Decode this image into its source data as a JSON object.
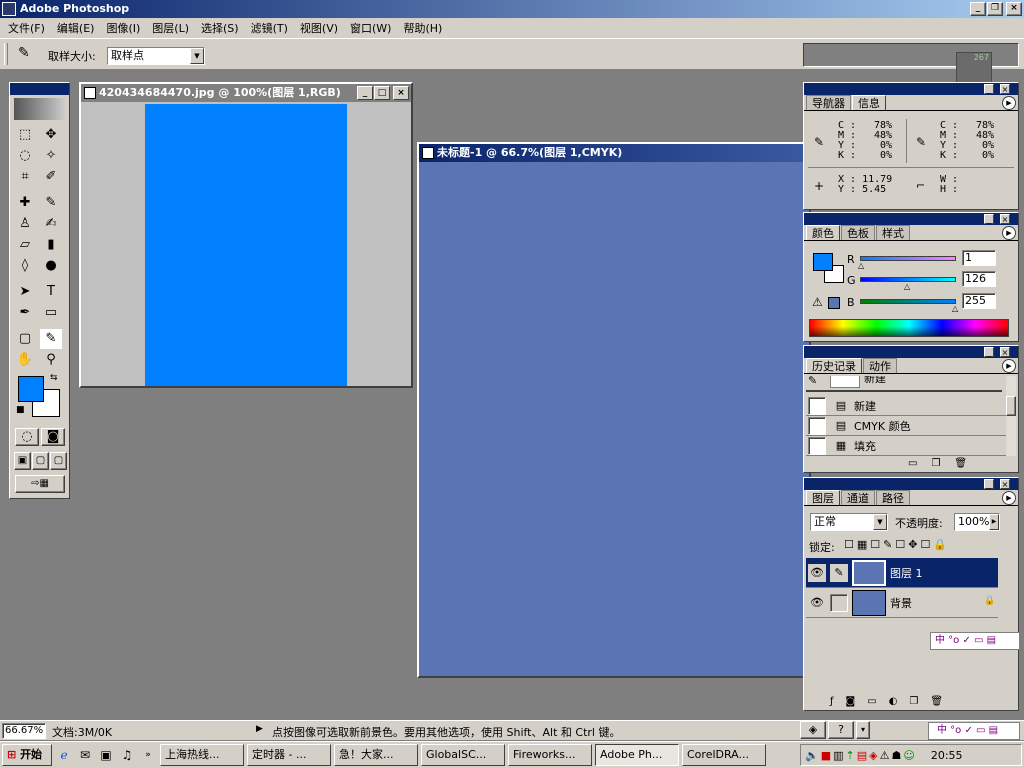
{
  "app": {
    "title": "Adobe Photoshop"
  },
  "menu": [
    "文件(F)",
    "编辑(E)",
    "图像(I)",
    "图层(L)",
    "选择(S)",
    "滤镜(T)",
    "视图(V)",
    "窗口(W)",
    "帮助(H)"
  ],
  "options": {
    "sample_label": "取样大小:",
    "sample_value": "取样点"
  },
  "documents": [
    {
      "title": "420434684470.jpg @ 100%(图层 1,RGB)",
      "fill": "#0080ff"
    },
    {
      "title": "未标题-1 @ 66.7%(图层 1,CMYK)",
      "fill": "#5a74b4"
    }
  ],
  "navigator": {
    "tabs": [
      "导航器",
      "信息"
    ],
    "cmyk_labels": [
      "C :",
      "M :",
      "Y :",
      "K :"
    ],
    "cmyk1": [
      "78%",
      "48%",
      "0%",
      "0%"
    ],
    "cmyk2": [
      "78%",
      "48%",
      "0%",
      "0%"
    ],
    "x": "X : 11.79",
    "y": "Y :  5.45",
    "w": "W :",
    "h": "H :"
  },
  "color": {
    "tabs": [
      "颜色",
      "色板",
      "样式"
    ],
    "labels": [
      "R",
      "G",
      "B"
    ],
    "values": [
      "1",
      "126",
      "255"
    ],
    "foreground": "#0080ff"
  },
  "history": {
    "tabs": [
      "历史记录",
      "动作"
    ],
    "top_item": "新建",
    "items": [
      "新建",
      "CMYK 颜色",
      "填充"
    ]
  },
  "layers": {
    "tabs": [
      "图层",
      "通道",
      "路径"
    ],
    "blend": "正常",
    "opacity_label": "不透明度:",
    "opacity": "100%",
    "lock_label": "锁定:",
    "items": [
      "图层 1",
      "背景"
    ]
  },
  "status": {
    "zoom": "66.67%",
    "doc": "文档:3M/0K",
    "hint": "点按图像可选取新前景色。要用其他选项，使用 Shift、Alt 和 Ctrl 键。"
  },
  "taskbar": {
    "start": "开始",
    "tasks": [
      "上海热线...",
      "定时器 - ...",
      "急！大家...",
      "GlobalSC...",
      "Fireworks...",
      "Adobe Ph...",
      "CorelDRA..."
    ],
    "clock": "20:55"
  },
  "widget": {
    "value": "267"
  },
  "ime": {
    "text": "中 °o ✓ ▭ ▤"
  }
}
